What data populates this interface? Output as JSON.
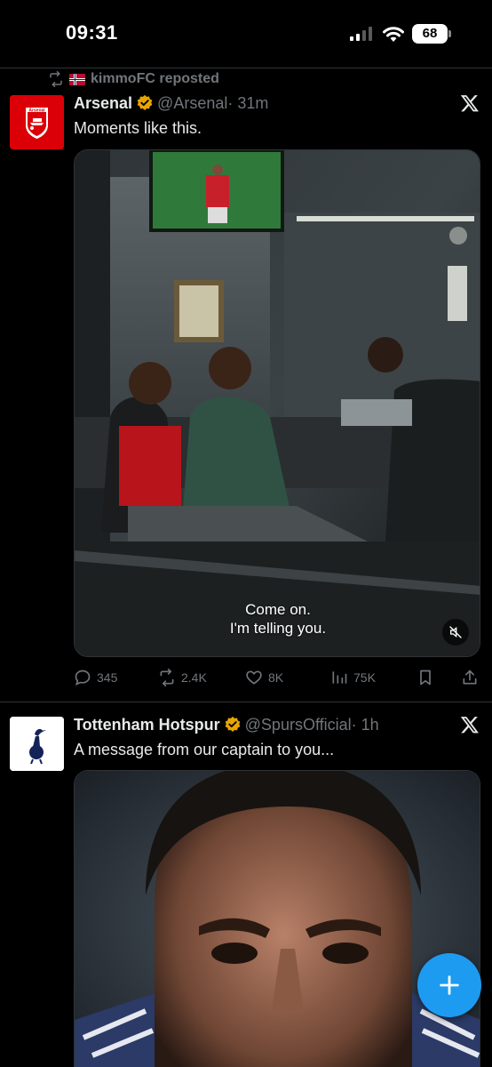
{
  "status_bar": {
    "time": "09:31",
    "battery": "68"
  },
  "repost": {
    "text": "kimmoFC reposted"
  },
  "tweets": [
    {
      "name": "Arsenal",
      "handle": "@Arsenal",
      "time": "· 31m",
      "text": "Moments like this.",
      "avatar_label": "Arsenal",
      "media": {
        "caption_line1": "Come on.",
        "caption_line2": "I'm telling you."
      },
      "actions": {
        "replies": "345",
        "reposts": "2.4K",
        "likes": "8K",
        "views": "75K"
      }
    },
    {
      "name": "Tottenham Hotspur",
      "handle": "@SpursOfficial",
      "time": "· 1h",
      "text": "A message from our captain to you..."
    }
  ],
  "icons": {
    "repost": "repost-icon",
    "verified": "verified-badge-icon",
    "x": "x-logo-icon",
    "reply": "reply-icon",
    "like": "heart-icon",
    "views": "views-icon",
    "bookmark": "bookmark-icon",
    "share": "share-icon",
    "mute": "muted-speaker-icon",
    "compose": "plus-icon"
  },
  "colors": {
    "accent": "#1d9bf0",
    "verified": "#e8a500",
    "muted_text": "#71767b",
    "arsenal_red": "#db0007"
  }
}
